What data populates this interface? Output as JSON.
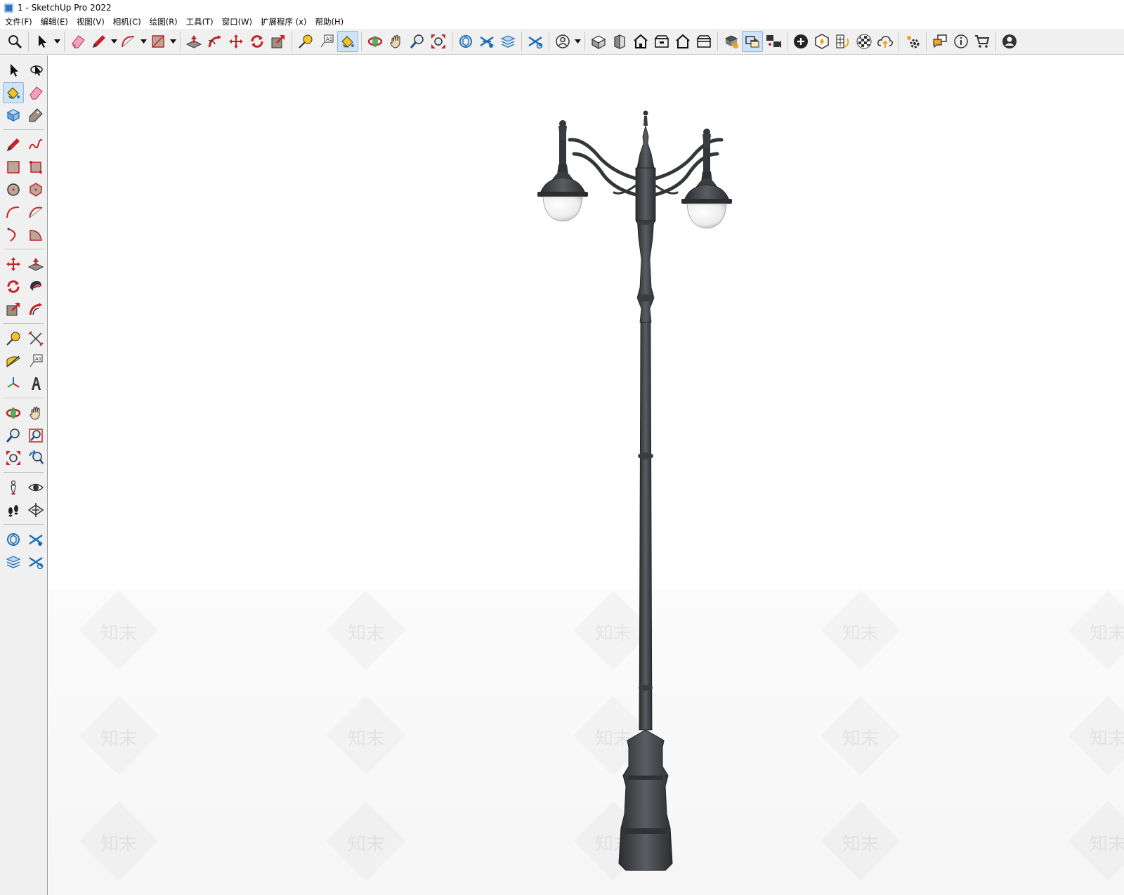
{
  "window": {
    "title": "1 - SketchUp Pro 2022"
  },
  "menu": {
    "items": [
      "文件(F)",
      "编辑(E)",
      "视图(V)",
      "相机(C)",
      "绘图(R)",
      "工具(T)",
      "窗口(W)",
      "扩展程序 (x)",
      "帮助(H)"
    ]
  },
  "toolbar": {
    "icons": [
      "search-icon",
      "select-arrow-icon",
      "eraser-icon",
      "pencil-line-icon",
      "arc-icon",
      "rectangle-icon",
      "push-pull-icon",
      "follow-me-icon",
      "move-icon",
      "rotate-icon",
      "scale-icon",
      "tape-measure-icon",
      "text-label-icon",
      "paint-bucket-icon",
      "orbit-icon",
      "pan-hand-icon",
      "zoom-icon",
      "zoom-extents-icon",
      "model-info-icon",
      "layers-icon",
      "tags-icon",
      "styles-icon",
      "account-icon",
      "iso-view-icon",
      "front-view-icon",
      "top-view-icon",
      "right-view-icon",
      "back-view-icon",
      "left-view-icon",
      "components-icon",
      "materials-icon",
      "scenes-icon",
      "add-icon",
      "extension-icon",
      "solar-icon",
      "texture-icon",
      "cloud-upload-icon",
      "settings-gear-icon",
      "messages-icon",
      "info-icon",
      "cart-icon",
      "user-avatar-icon"
    ]
  },
  "watermark": {
    "text": "知末"
  },
  "colors": {
    "toolbar_bg": "#f0f0f0",
    "active_tool": "#cfe3f6",
    "lamp_metal": "#3a3d40",
    "lamp_glass": "#f4f4f4"
  }
}
